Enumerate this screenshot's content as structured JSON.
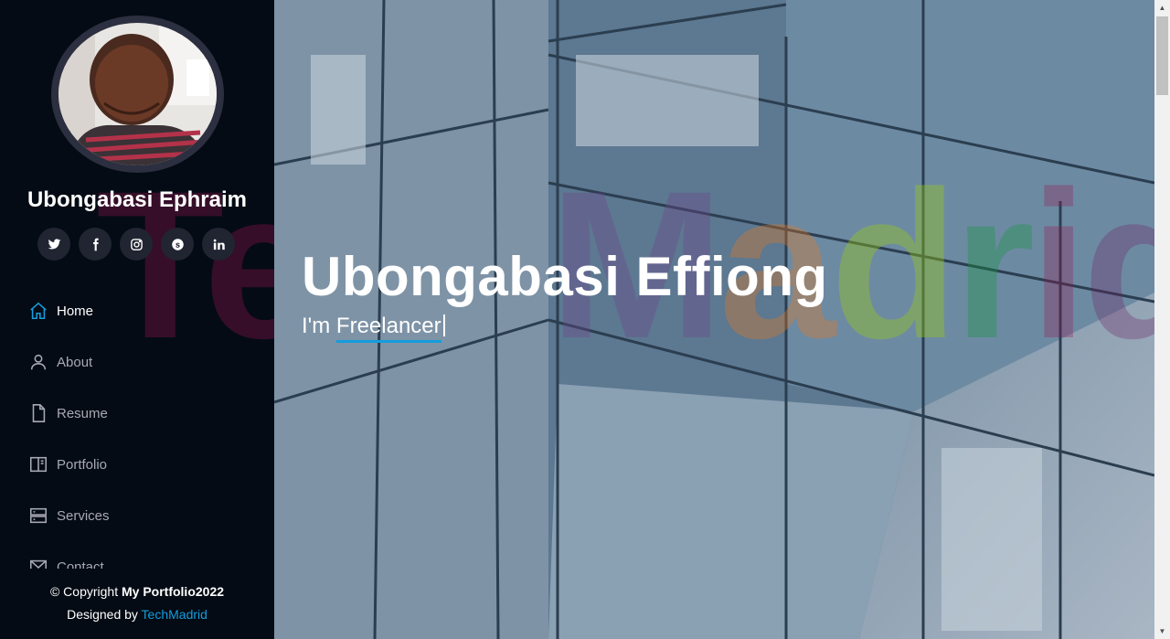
{
  "sidebar": {
    "profile_name": "Ubongabasi Ephraim",
    "social": [
      {
        "icon": "twitter-icon"
      },
      {
        "icon": "facebook-icon"
      },
      {
        "icon": "instagram-icon"
      },
      {
        "icon": "skype-icon"
      },
      {
        "icon": "linkedin-icon"
      }
    ],
    "nav": [
      {
        "label": "Home",
        "icon": "home-icon",
        "active": true
      },
      {
        "label": "About",
        "icon": "person-icon"
      },
      {
        "label": "Resume",
        "icon": "file-icon"
      },
      {
        "label": "Portfolio",
        "icon": "book-icon"
      },
      {
        "label": "Services",
        "icon": "server-icon"
      },
      {
        "label": "Contact",
        "icon": "envelope-icon"
      }
    ],
    "copyright_prefix": "© Copyright",
    "copyright_brand": "My Portfolio2022",
    "designed_prefix": "Designed by",
    "designed_link": "TechMadrid"
  },
  "watermark": "TechMadrid",
  "hero": {
    "title": "Ubongabasi Effiong",
    "subtitle_prefix": "I'm",
    "subtitle_typed": "Freelancer"
  },
  "colors": {
    "sidebar_bg": "#040b14",
    "accent": "#149ddd",
    "nav_text": "#a8a9b4"
  }
}
